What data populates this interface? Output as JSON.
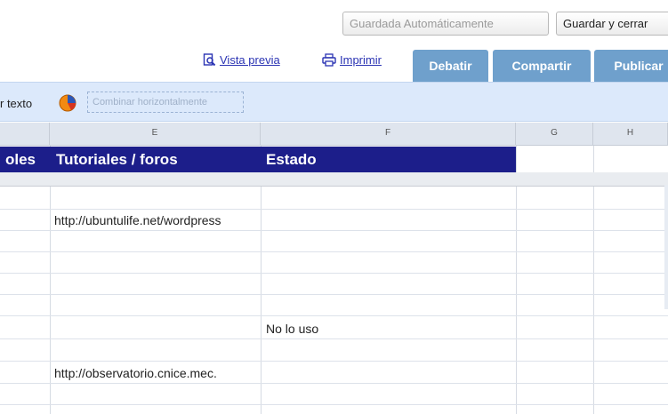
{
  "top": {
    "autosave_label": "Guardada Automáticamente",
    "save_close_label": "Guardar y cerrar"
  },
  "links": {
    "preview_label": "Vista previa",
    "print_label": "Imprimir"
  },
  "tabs": {
    "debatir": "Debatir",
    "compartir": "Compartir",
    "publicar": "Publicar"
  },
  "toolbar": {
    "text_label": "r texto",
    "merge_label": "Combinar horizontalmente"
  },
  "grid": {
    "columns": [
      "E",
      "F",
      "G",
      "H"
    ],
    "header": {
      "col_d": "oles",
      "col_e": "Tutoriales / foros",
      "col_f": "Estado"
    },
    "cells": {
      "e_row3": "http://ubuntulife.net/wordpress",
      "f_row9": "No lo uso",
      "e_row11": "http://observatorio.cnice.mec."
    }
  },
  "colors": {
    "header_bg": "#1c1e8a",
    "tab_bg": "#6fa0cc",
    "toolbar_bg": "#dce9fb",
    "link": "#2a33b3"
  }
}
